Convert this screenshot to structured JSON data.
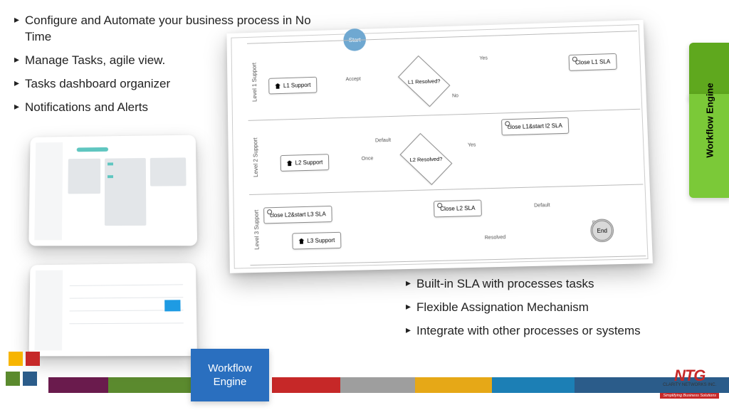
{
  "bullets_top": [
    "Configure and Automate your business process in No Time",
    "Manage Tasks, agile view.",
    "Tasks dashboard organizer",
    "Notifications and Alerts"
  ],
  "bullets_bottom": [
    "Built-in SLA with processes tasks",
    "Flexible Assignation Mechanism",
    "Integrate with other processes or systems"
  ],
  "workflow": {
    "lanes": [
      "Level 1 Support",
      "Level 2 Support",
      "Level 3 Support"
    ],
    "nodes": {
      "start": "Start",
      "end": "End",
      "l1_support": "L1 Support",
      "l1_resolved": "L1 Resolved?",
      "close_l1": "Close L1 SLA",
      "close_l1_start_l2": "close L1&start l2 SLA",
      "l2_support": "L2 Support",
      "l2_resolved": "L2 Resolved?",
      "close_l2": "Close L2 SLA",
      "close_l2_start_l3": "close L2&start L3 SLA",
      "l3_support": "L3 Support"
    },
    "edges": {
      "accept": "Accept",
      "yes": "Yes",
      "no": "No",
      "default": "Default",
      "once": "Once",
      "resolved": "Resolved"
    }
  },
  "side_tab": "Workflow Engine",
  "blue_card": "Workflow Engine",
  "logo": {
    "main": "NTG",
    "sub": "CLARITY NETWORKS INC.",
    "tag": "Simplifying Business Solutions"
  }
}
